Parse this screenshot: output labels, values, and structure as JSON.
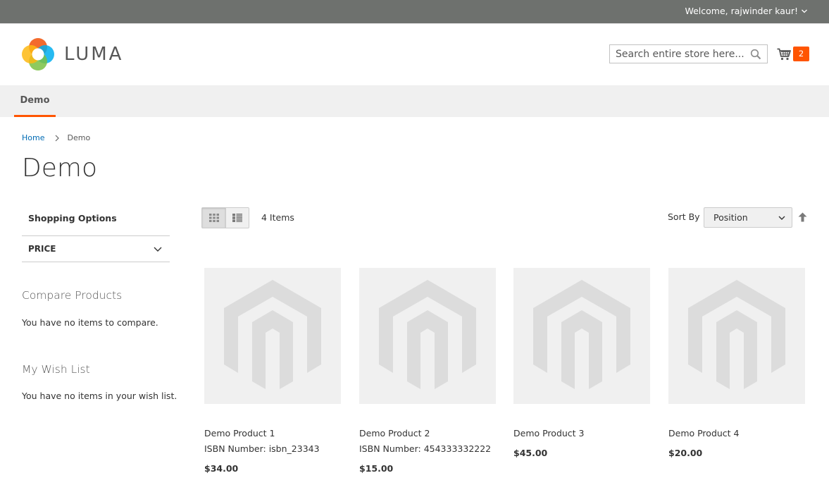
{
  "header": {
    "welcome": "Welcome, rajwinder kaur!",
    "logo_text": "LUMA",
    "search_placeholder": "Search entire store here...",
    "cart_count": "2",
    "brand_color": "#ff5501"
  },
  "nav": {
    "items": [
      {
        "label": "Demo"
      }
    ]
  },
  "breadcrumb": {
    "home": "Home",
    "current": "Demo"
  },
  "page": {
    "title": "Demo"
  },
  "sidebar": {
    "shopping_options": "Shopping Options",
    "filter_price": "PRICE",
    "compare_title": "Compare Products",
    "compare_text": "You have no items to compare.",
    "wishlist_title": "My Wish List",
    "wishlist_text": "You have no items in your wish list."
  },
  "toolbar": {
    "view_grid": "grid-icon",
    "view_list": "list-icon",
    "amount": "4 Items",
    "sort_label": "Sort By",
    "sort_value": "Position"
  },
  "products": [
    {
      "name": "Demo Product 1",
      "isbn": "ISBN Number: isbn_23343",
      "price": "$34.00"
    },
    {
      "name": "Demo Product 2",
      "isbn": "ISBN Number: 454333332222",
      "price": "$15.00"
    },
    {
      "name": "Demo Product 3",
      "isbn": "",
      "price": "$45.00"
    },
    {
      "name": "Demo Product 4",
      "isbn": "",
      "price": "$20.00"
    }
  ]
}
